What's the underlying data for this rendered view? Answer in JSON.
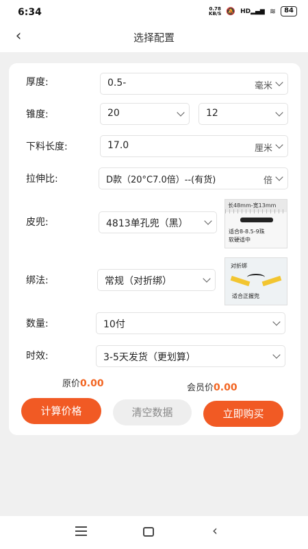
{
  "status": {
    "time": "6:34",
    "speed_value": "0.78",
    "speed_unit": "KB/S",
    "network": "HD",
    "battery": "84"
  },
  "header": {
    "title": "选择配置",
    "back_icon": "chevron-left-icon"
  },
  "form": {
    "thickness": {
      "label": "厚度:",
      "value": "0.5-",
      "unit": "毫米"
    },
    "taper": {
      "label": "锥度:",
      "value1": "20",
      "value2": "12"
    },
    "cut_length": {
      "label": "下料长度:",
      "value": "17.0",
      "unit": "厘米"
    },
    "stretch_ratio": {
      "label": "拉伸比:",
      "value": "D款（20°C7.0倍）--(有货)",
      "unit": "倍"
    },
    "pouch": {
      "label": "皮兜:",
      "value": "4813单孔兜（黑）",
      "image_caption_top": "长48mm-宽13mm",
      "image_caption_1": "适合8-8.5-9珠",
      "image_caption_2": "软硬适中"
    },
    "binding": {
      "label": "绑法:",
      "value": "常规（对折绑）",
      "image_caption_top": "对折绑",
      "image_caption_bottom": "适合正握兜"
    },
    "quantity": {
      "label": "数量:",
      "value": "10付"
    },
    "timing": {
      "label": "时效:",
      "value": "3-5天发货（更划算）"
    }
  },
  "prices": {
    "original_label": "原价",
    "original_value": "0.00",
    "member_label": "会员价",
    "member_value": "0.00"
  },
  "buttons": {
    "calculate": "计算价格",
    "clear": "清空数据",
    "buy": "立即购买"
  },
  "colors": {
    "accent": "#f15a24",
    "price": "#f26522",
    "strap": "#f2c530"
  }
}
